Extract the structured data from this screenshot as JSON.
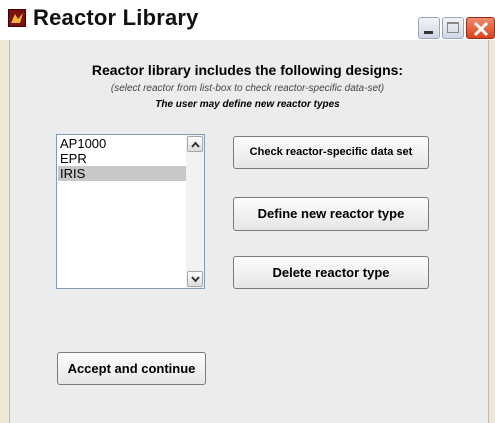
{
  "window": {
    "title": "Reactor Library",
    "icon": "matlab-figure-icon",
    "controls": [
      "minimize-icon",
      "maximize-icon",
      "close-icon"
    ],
    "close_color": "#d9431e"
  },
  "header": {
    "heading": "Reactor library includes the following designs:",
    "subheading": "(select reactor from list-box to check reactor-specific data-set)",
    "note": "The user may define new reactor types"
  },
  "reactor_list": {
    "items": [
      {
        "label": "AP1000",
        "selected": false
      },
      {
        "label": "EPR",
        "selected": false
      },
      {
        "label": "IRIS",
        "selected": true
      }
    ],
    "selected_color": "#c8c8c8"
  },
  "buttons": {
    "check_label": "Check reactor-specific data set",
    "define_label": "Define new reactor type",
    "delete_label": "Delete reactor type",
    "accept_label": "Accept and continue"
  }
}
